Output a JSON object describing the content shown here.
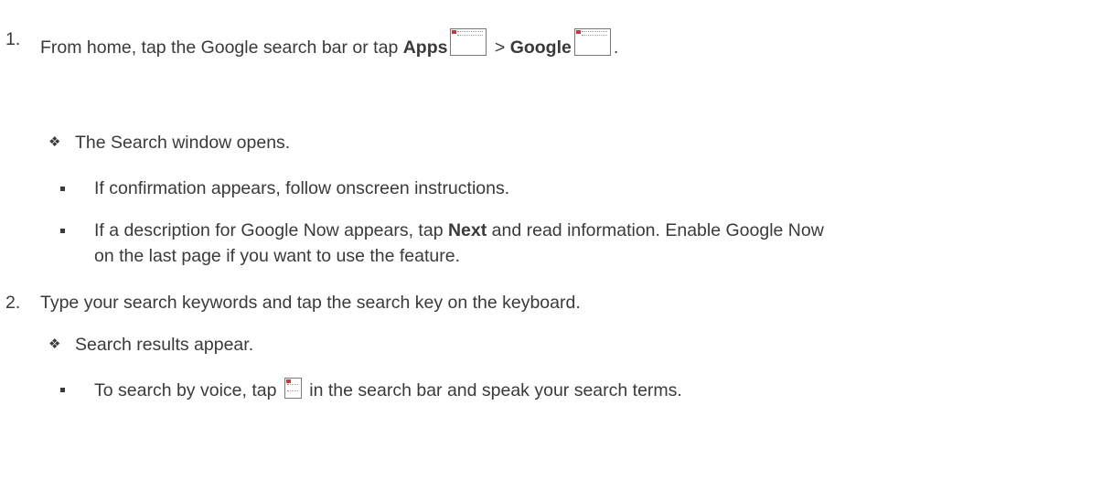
{
  "steps": [
    {
      "number": "1.",
      "text_a": "From home, tap the Google search bar or tap ",
      "bold_a": "Apps",
      "icon_a": "apps-icon",
      "text_b": " > ",
      "bold_b": "Google",
      "icon_b": "google-app-icon",
      "text_c": "."
    },
    {
      "number": "2.",
      "text": "Type your search keywords and tap the search key on the keyboard."
    }
  ],
  "result_1": "The Search window opens.",
  "sub_1a": "If confirmation appears, follow onscreen instructions.",
  "sub_1b": {
    "text_a": "If a description for Google Now appears, tap ",
    "bold": "Next",
    "text_b": " and read information. Enable Google Now",
    "line2": "on the last page if you want to use the feature."
  },
  "result_2": "Search results appear.",
  "sub_2a": {
    "text_a": "To search by voice, tap ",
    "icon": "microphone-icon",
    "text_b": " in the search bar and speak your search terms."
  },
  "bullet_colors": {
    "text": "#3a3a3a",
    "icon_accent": "#c43a3a"
  }
}
